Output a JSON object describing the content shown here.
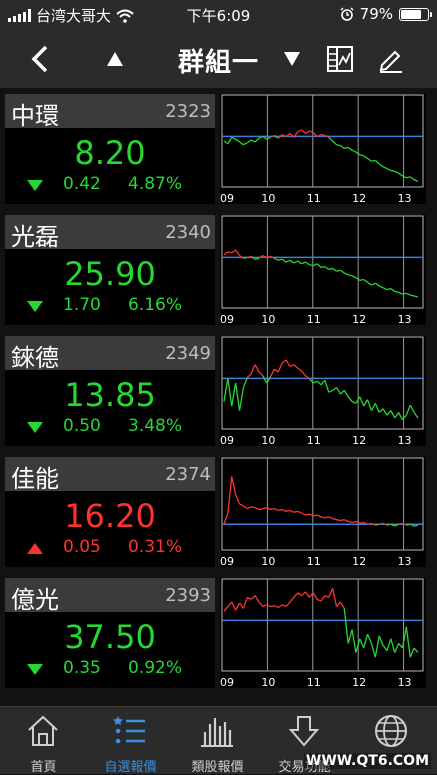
{
  "status_bar": {
    "carrier": "台湾大哥大",
    "time": "下午6:09",
    "battery_text": "79%",
    "battery_level": 0.79
  },
  "nav": {
    "title": "群組一"
  },
  "stocks": [
    {
      "name": "中環",
      "code": "2323",
      "price": "8.20",
      "change": "0.42",
      "percent": "4.87%",
      "direction": "down",
      "color": "#27d832",
      "chart_data": {
        "type": "line",
        "x_ticks": [
          "09",
          "10",
          "11",
          "12",
          "13"
        ],
        "y_range": [
          0,
          100
        ],
        "ref": 55,
        "series": [
          {
            "values": [
              50,
              47,
              54,
              52,
              49,
              46,
              48,
              51,
              49,
              53,
              55,
              52,
              54,
              56,
              53,
              57,
              55,
              58,
              54,
              60,
              62,
              58,
              61,
              59,
              55,
              57,
              56,
              54,
              50,
              46,
              45,
              42,
              43,
              40,
              38,
              35,
              34,
              31,
              28,
              29,
              25,
              22,
              20,
              18,
              17,
              15,
              12,
              10,
              11,
              8,
              6
            ]
          }
        ]
      }
    },
    {
      "name": "光磊",
      "code": "2340",
      "price": "25.90",
      "change": "1.70",
      "percent": "6.16%",
      "direction": "down",
      "color": "#27d832",
      "chart_data": {
        "type": "line",
        "x_ticks": [
          "09",
          "10",
          "11",
          "12",
          "13"
        ],
        "y_range": [
          0,
          100
        ],
        "ref": 55,
        "series": [
          {
            "values": [
              58,
              61,
              60,
              63,
              57,
              54,
              55,
              56,
              53,
              54,
              57,
              55,
              56,
              54,
              52,
              53,
              50,
              52,
              49,
              51,
              48,
              50,
              47,
              46,
              48,
              44,
              45,
              42,
              43,
              40,
              41,
              38,
              36,
              35,
              33,
              30,
              31,
              28,
              25,
              27,
              24,
              22,
              20,
              21,
              18,
              17,
              15,
              16,
              14,
              13,
              12
            ]
          }
        ]
      }
    },
    {
      "name": "錸德",
      "code": "2349",
      "price": "13.85",
      "change": "0.50",
      "percent": "3.48%",
      "direction": "down",
      "color": "#27d832",
      "chart_data": {
        "type": "line",
        "x_ticks": [
          "09",
          "10",
          "11",
          "12",
          "13"
        ],
        "y_range": [
          0,
          100
        ],
        "ref": 55,
        "series": [
          {
            "values": [
              30,
              55,
              25,
              50,
              20,
              45,
              56,
              60,
              70,
              62,
              58,
              50,
              57,
              65,
              62,
              72,
              75,
              68,
              70,
              66,
              63,
              58,
              55,
              50,
              52,
              48,
              53,
              40,
              42,
              45,
              38,
              42,
              35,
              30,
              28,
              35,
              25,
              32,
              20,
              28,
              18,
              22,
              15,
              20,
              12,
              18,
              10,
              15,
              26,
              18,
              12
            ]
          }
        ]
      }
    },
    {
      "name": "佳能",
      "code": "2374",
      "price": "16.20",
      "change": "0.05",
      "percent": "0.31%",
      "direction": "up",
      "color": "#ff3232",
      "chart_data": {
        "type": "line",
        "x_ticks": [
          "09",
          "10",
          "11",
          "12",
          "13"
        ],
        "y_range": [
          0,
          100
        ],
        "ref": 28,
        "series": [
          {
            "values": [
              28,
              40,
              80,
              60,
              50,
              48,
              45,
              47,
              46,
              44,
              45,
              46,
              44,
              45,
              43,
              44,
              42,
              43,
              41,
              42,
              40,
              38,
              39,
              37,
              38,
              36,
              35,
              36,
              34,
              33,
              32,
              33,
              31,
              30,
              31,
              29,
              30,
              28,
              29,
              27,
              28,
              29,
              27,
              28,
              26,
              28,
              29,
              27,
              28,
              26,
              27
            ]
          }
        ]
      }
    },
    {
      "name": "億光",
      "code": "2393",
      "price": "37.50",
      "change": "0.35",
      "percent": "0.92%",
      "direction": "down",
      "color": "#27d832",
      "chart_data": {
        "type": "line",
        "x_ticks": [
          "09",
          "10",
          "11",
          "12",
          "13"
        ],
        "y_range": [
          0,
          100
        ],
        "ref": 55,
        "series": [
          {
            "values": [
              65,
              70,
              75,
              66,
              74,
              68,
              80,
              78,
              82,
              75,
              70,
              72,
              70,
              71,
              69,
              72,
              70,
              75,
              80,
              85,
              82,
              86,
              80,
              85,
              78,
              76,
              82,
              80,
              90,
              70,
              75,
              68,
              30,
              45,
              20,
              35,
              25,
              40,
              30,
              15,
              38,
              28,
              22,
              35,
              20,
              30,
              25,
              48,
              15,
              25,
              20
            ]
          }
        ]
      }
    }
  ],
  "tabs": [
    {
      "label": "首頁",
      "icon": "home-icon",
      "active": false
    },
    {
      "label": "自選報價",
      "icon": "watchlist-icon",
      "active": true
    },
    {
      "label": "類股報價",
      "icon": "bar-chart-icon",
      "active": false
    },
    {
      "label": "交易功能",
      "icon": "download-icon",
      "active": false
    },
    {
      "label": "",
      "icon": "globe-icon",
      "active": false
    }
  ],
  "watermark": "WWW.QT6.COM",
  "colors": {
    "up": "#ff3232",
    "down": "#27d832",
    "reference_line": "#3d7fd6",
    "active_tab": "#3d8fe0"
  }
}
